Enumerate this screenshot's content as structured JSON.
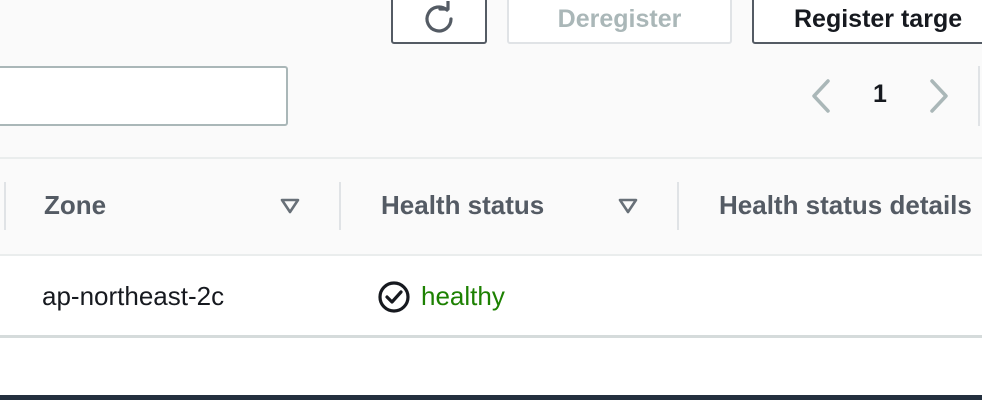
{
  "toolbar": {
    "refresh_icon": "refresh-icon",
    "deregister_label": "Deregister",
    "register_label": "Register targe"
  },
  "filter": {
    "placeholder": ""
  },
  "pagination": {
    "current_page": "1",
    "prev_icon": "chevron-left-icon",
    "next_icon": "chevron-right-icon"
  },
  "table": {
    "columns": [
      {
        "label": "Zone",
        "sortable": true
      },
      {
        "label": "Health status",
        "sortable": true
      },
      {
        "label": "Health status details",
        "sortable": false
      }
    ],
    "rows": [
      {
        "zone": "ap-northeast-2c",
        "health_status": "healthy",
        "health_status_icon": "check-circle-icon",
        "health_status_details": ""
      }
    ]
  },
  "colors": {
    "healthy": "#1d8102",
    "header_text": "#545b64",
    "disabled_text": "#aab7b8"
  }
}
